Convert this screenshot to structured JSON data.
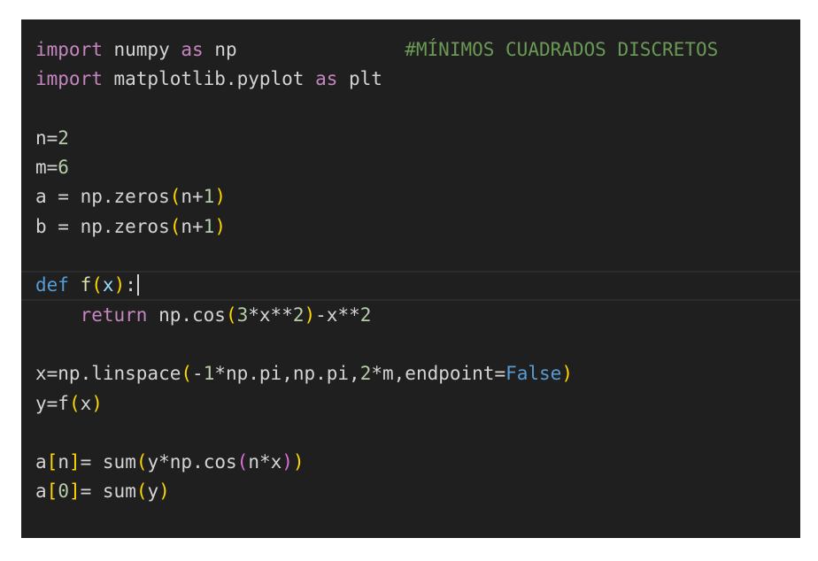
{
  "editor": {
    "background": "#1f1f1f",
    "lines": [
      {
        "tokens": [
          [
            "kw",
            "import"
          ],
          [
            "tx",
            " numpy "
          ],
          [
            "kw",
            "as"
          ],
          [
            "tx",
            " np               "
          ],
          [
            "cm",
            "#MÍNIMOS CUADRADOS DISCRETOS"
          ]
        ]
      },
      {
        "tokens": [
          [
            "kw",
            "import"
          ],
          [
            "tx",
            " matplotlib.pyplot "
          ],
          [
            "kw",
            "as"
          ],
          [
            "tx",
            " plt"
          ]
        ]
      },
      {
        "tokens": []
      },
      {
        "tokens": [
          [
            "tx",
            "n="
          ],
          [
            "num",
            "2"
          ]
        ]
      },
      {
        "tokens": [
          [
            "tx",
            "m="
          ],
          [
            "num",
            "6"
          ]
        ]
      },
      {
        "tokens": [
          [
            "tx",
            "a = np.zeros"
          ],
          [
            "p1",
            "("
          ],
          [
            "tx",
            "n+"
          ],
          [
            "num",
            "1"
          ],
          [
            "p1",
            ")"
          ]
        ]
      },
      {
        "tokens": [
          [
            "tx",
            "b = np.zeros"
          ],
          [
            "p1",
            "("
          ],
          [
            "tx",
            "n+"
          ],
          [
            "num",
            "1"
          ],
          [
            "p1",
            ")"
          ]
        ]
      },
      {
        "tokens": []
      },
      {
        "active": true,
        "tokens": [
          [
            "kwb",
            "def"
          ],
          [
            "tx",
            " "
          ],
          [
            "fn",
            "f"
          ],
          [
            "p1",
            "("
          ],
          [
            "var",
            "x"
          ],
          [
            "p1",
            ")"
          ],
          [
            "tx",
            ":"
          ]
        ]
      },
      {
        "tokens": [
          [
            "tx",
            "    "
          ],
          [
            "kw",
            "return"
          ],
          [
            "tx",
            " np.cos"
          ],
          [
            "p1",
            "("
          ],
          [
            "num",
            "3"
          ],
          [
            "tx",
            "*x**"
          ],
          [
            "num",
            "2"
          ],
          [
            "p1",
            ")"
          ],
          [
            "tx",
            "-x**"
          ],
          [
            "num",
            "2"
          ]
        ]
      },
      {
        "tokens": []
      },
      {
        "tokens": [
          [
            "tx",
            "x=np.linspace"
          ],
          [
            "p1",
            "("
          ],
          [
            "tx",
            "-"
          ],
          [
            "num",
            "1"
          ],
          [
            "tx",
            "*np.pi,np.pi,"
          ],
          [
            "num",
            "2"
          ],
          [
            "tx",
            "*m,endpoint="
          ],
          [
            "kwb",
            "False"
          ],
          [
            "p1",
            ")"
          ]
        ]
      },
      {
        "tokens": [
          [
            "tx",
            "y=f"
          ],
          [
            "p1",
            "("
          ],
          [
            "tx",
            "x"
          ],
          [
            "p1",
            ")"
          ]
        ]
      },
      {
        "tokens": []
      },
      {
        "tokens": [
          [
            "tx",
            "a"
          ],
          [
            "p1",
            "["
          ],
          [
            "tx",
            "n"
          ],
          [
            "p1",
            "]"
          ],
          [
            "tx",
            "= sum"
          ],
          [
            "p1",
            "("
          ],
          [
            "tx",
            "y*np.cos"
          ],
          [
            "p2",
            "("
          ],
          [
            "tx",
            "n*x"
          ],
          [
            "p2",
            ")"
          ],
          [
            "p1",
            ")"
          ]
        ]
      },
      {
        "tokens": [
          [
            "tx",
            "a"
          ],
          [
            "p1",
            "["
          ],
          [
            "num",
            "0"
          ],
          [
            "p1",
            "]"
          ],
          [
            "tx",
            "= sum"
          ],
          [
            "p1",
            "("
          ],
          [
            "tx",
            "y"
          ],
          [
            "p1",
            ")"
          ]
        ]
      }
    ]
  }
}
